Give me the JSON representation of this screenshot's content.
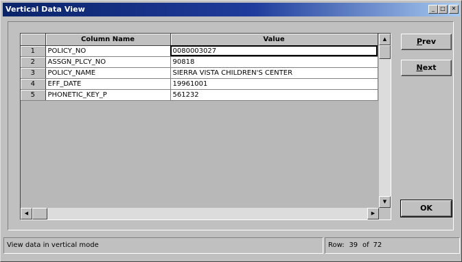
{
  "window": {
    "title": "Vertical Data View"
  },
  "grid": {
    "columns": [
      "Column Name",
      "Value"
    ],
    "rows": [
      {
        "num": "1",
        "name": "POLICY_NO",
        "value": "0080003027"
      },
      {
        "num": "2",
        "name": "ASSGN_PLCY_NO",
        "value": "90818"
      },
      {
        "num": "3",
        "name": "POLICY_NAME",
        "value": "SIERRA VISTA CHILDREN'S CENTER"
      },
      {
        "num": "4",
        "name": "EFF_DATE",
        "value": "19961001"
      },
      {
        "num": "5",
        "name": "PHONETIC_KEY_P",
        "value": "561232"
      }
    ]
  },
  "buttons": {
    "prev": {
      "mnemonic": "P",
      "rest": "rev"
    },
    "next": {
      "mnemonic": "N",
      "rest": "ext"
    },
    "ok": "OK"
  },
  "status": {
    "message": "View data in vertical mode",
    "row_label": "Row:",
    "current_row": "39",
    "of_label": "of",
    "total_rows": "72"
  },
  "colors": {
    "titlebar_start": "#0a246a",
    "titlebar_end": "#a6caf0",
    "face": "#c0c0c0"
  },
  "icons": [
    "minimize-icon",
    "maximize-icon",
    "close-icon",
    "scroll-up-arrow-icon",
    "scroll-down-arrow-icon",
    "scroll-left-arrow-icon",
    "scroll-right-arrow-icon"
  ]
}
